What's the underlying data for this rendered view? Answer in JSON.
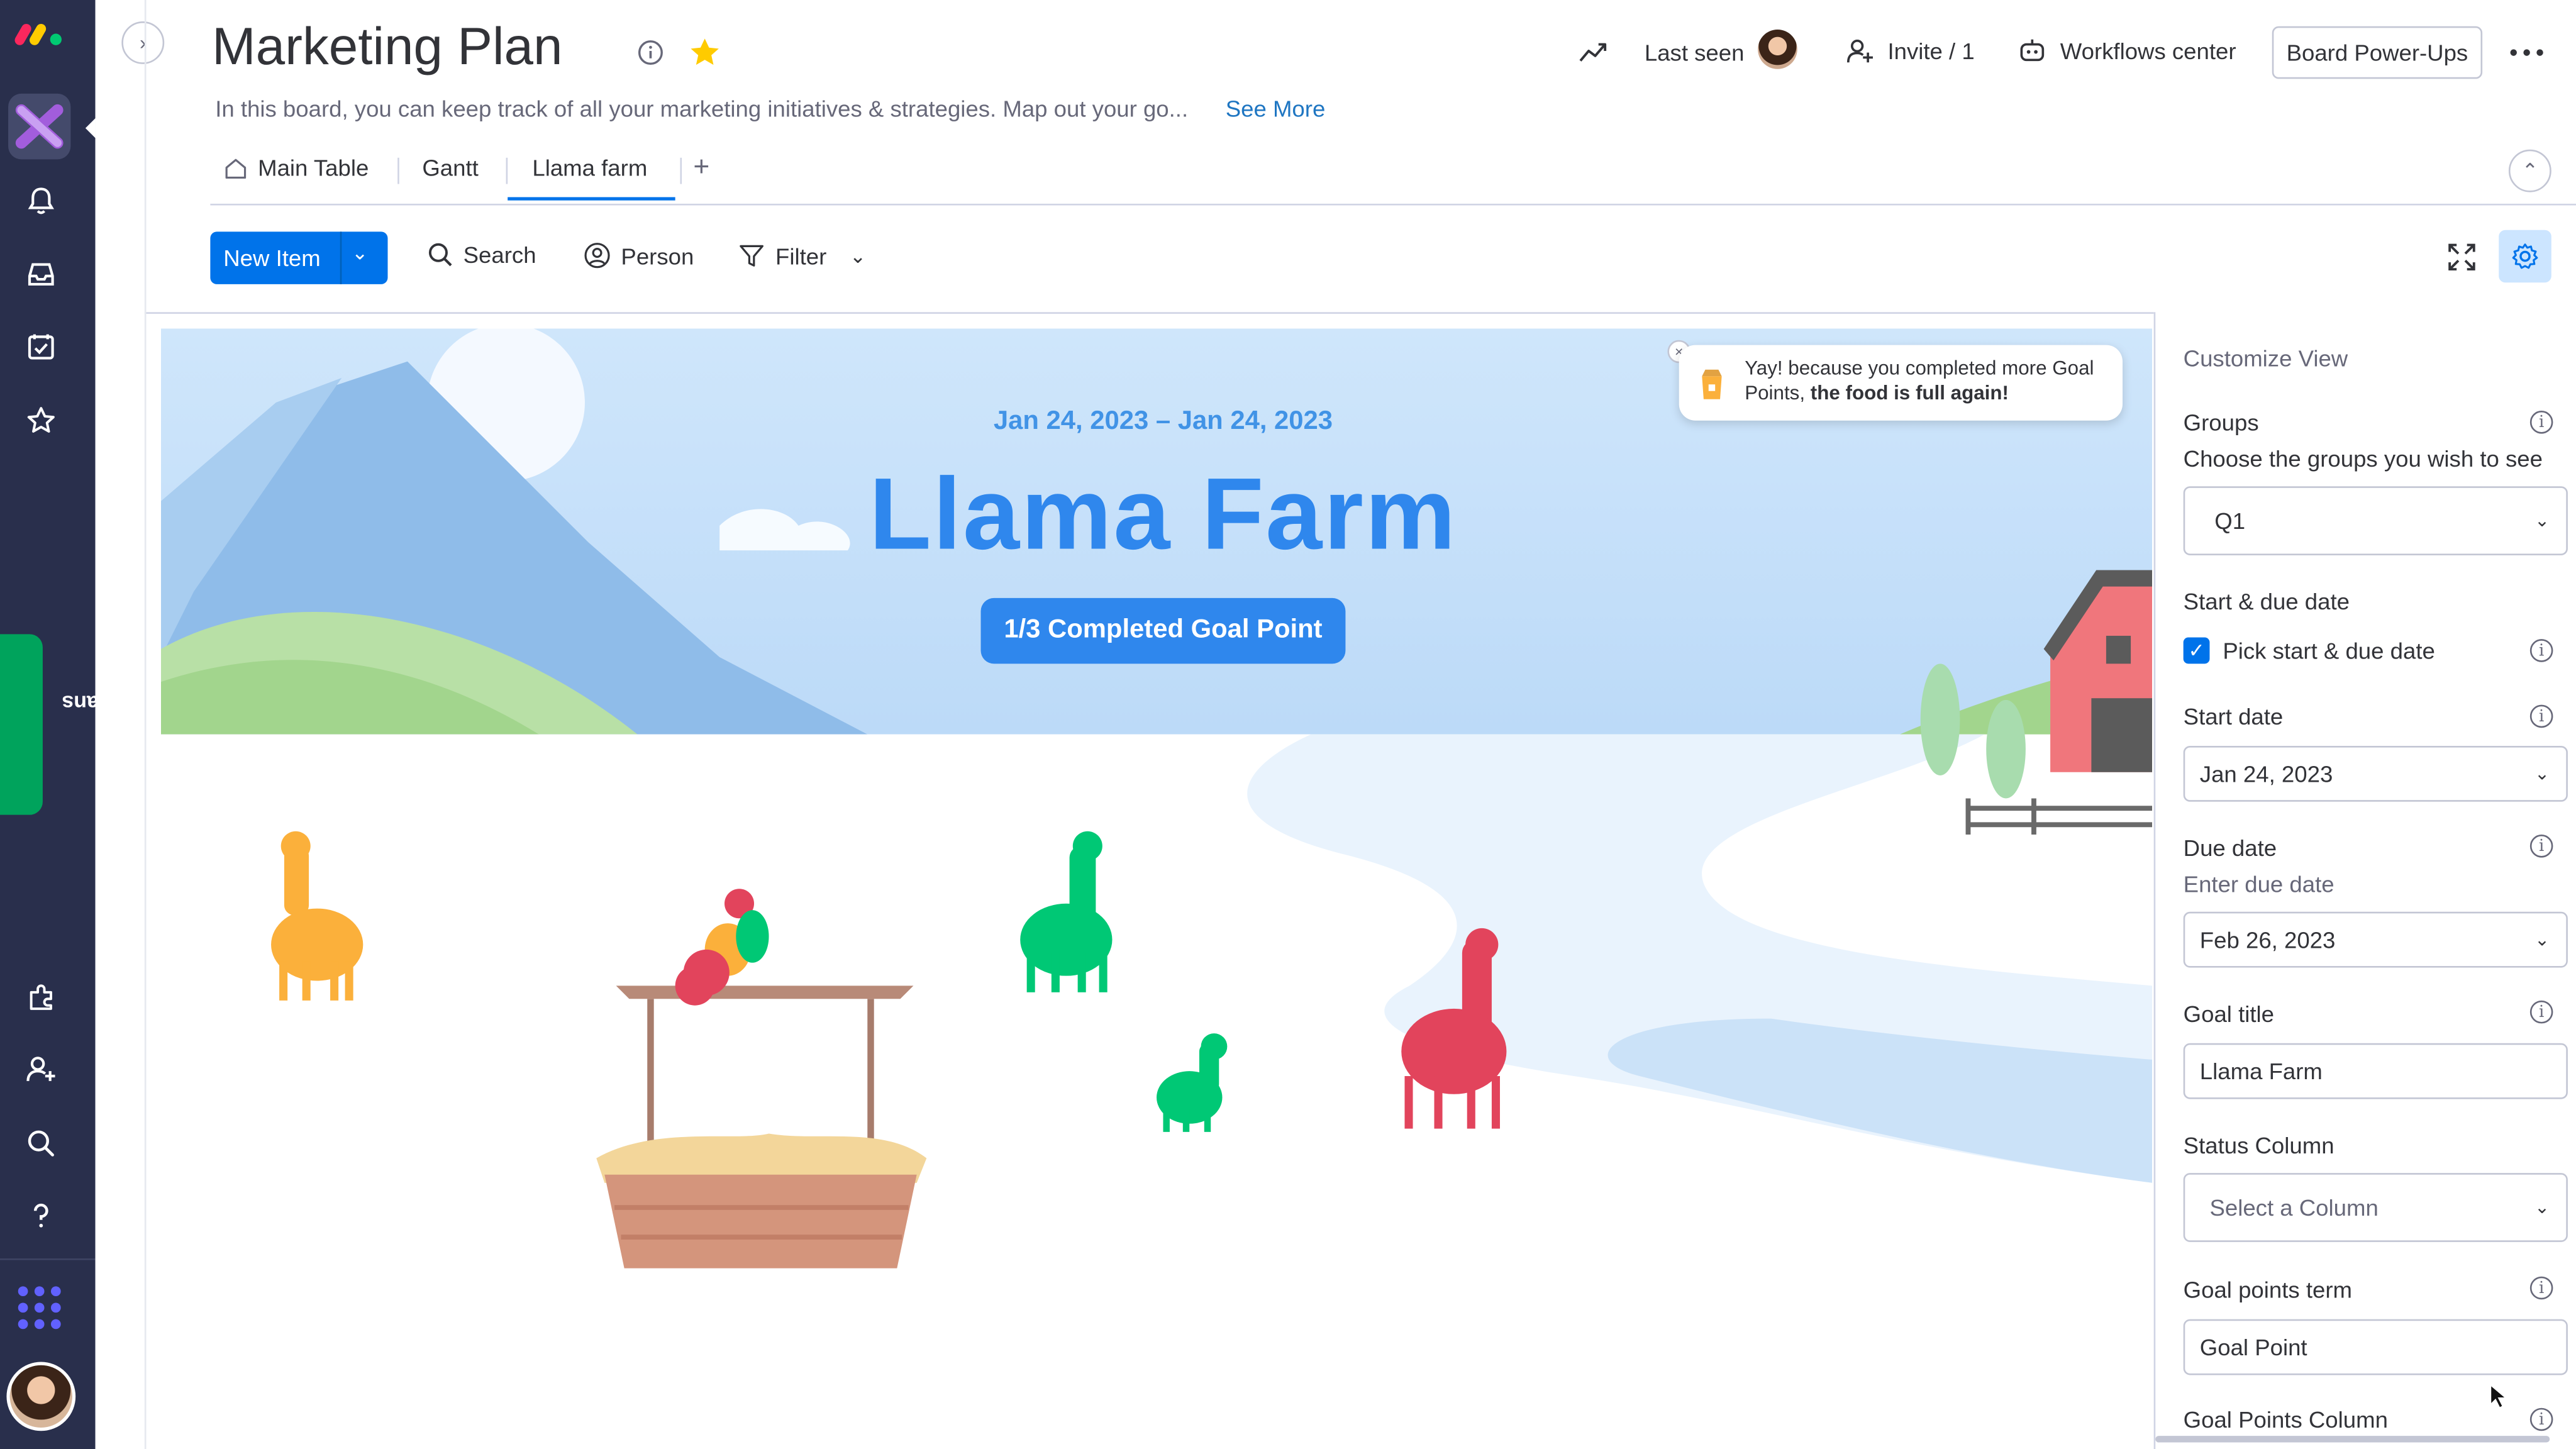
{
  "header": {
    "title": "Marketing Plan",
    "description": "In this board, you can keep track of all your marketing initiatives & strategies. Map out your go...",
    "see_more": "See More",
    "last_seen": "Last seen",
    "invite": "Invite / 1",
    "workflows": "Workflows center",
    "power_ups": "Board Power-Ups"
  },
  "tabs": [
    {
      "label": "Main Table"
    },
    {
      "label": "Gantt"
    },
    {
      "label": "Llama farm"
    }
  ],
  "toolbar": {
    "new_item": "New Item",
    "search": "Search",
    "person": "Person",
    "filter": "Filter"
  },
  "rail": {
    "see_plans": "See plans"
  },
  "scene": {
    "date_range": "Jan 24, 2023 – Jan 24, 2023",
    "title": "Llama Farm",
    "goal_badge": "1/3 Completed Goal Point",
    "toast_plain": "Yay! because you completed more Goal Points, ",
    "toast_bold": "the food is full again!"
  },
  "panel": {
    "heading": "Customize View",
    "groups_label": "Groups",
    "groups_sub": "Choose the groups you wish to see",
    "groups_value": "Q1",
    "dates_label": "Start & due date",
    "pick_dates": "Pick start & due date",
    "start_label": "Start date",
    "start_value": "Jan 24, 2023",
    "due_label": "Due date",
    "due_sub": "Enter due date",
    "due_value": "Feb 26, 2023",
    "goal_title_label": "Goal title",
    "goal_title_value": "Llama Farm",
    "status_label": "Status Column",
    "status_placeholder": "Select a Column",
    "points_term_label": "Goal points term",
    "points_term_value": "Goal Point",
    "points_column_label": "Goal Points Column"
  },
  "colors": {
    "rail": "#292f4c",
    "primary": "#0073ea",
    "see_plans": "#00a35c",
    "title_blue": "#2f87ed",
    "star": "#ffcb00"
  }
}
